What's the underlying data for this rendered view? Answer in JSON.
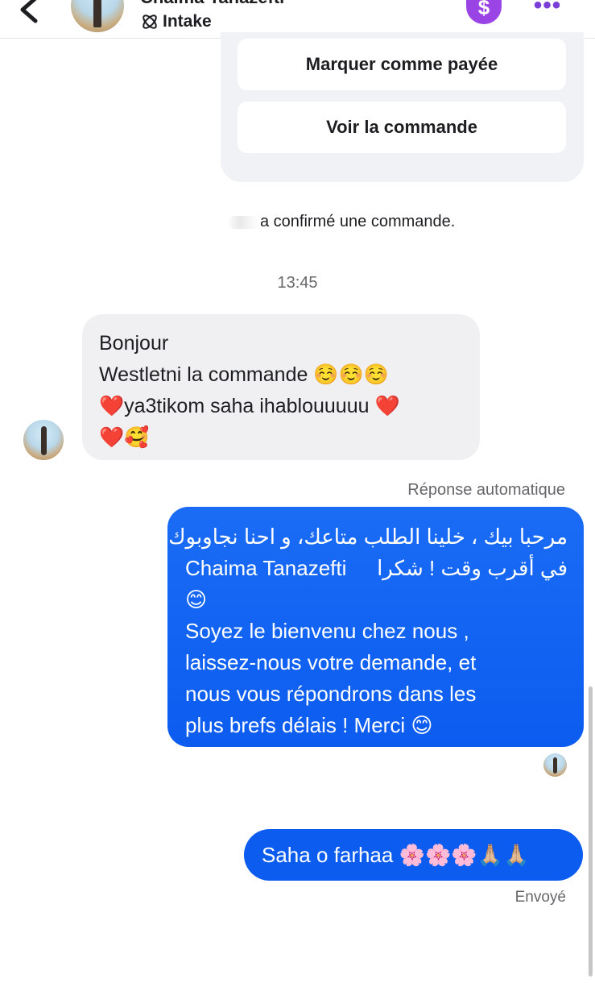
{
  "header": {
    "contact_name": "Chaima Tanazefti",
    "label": "Intake",
    "dollar_symbol": "$",
    "more_symbol": "•••"
  },
  "order_card": {
    "mark_paid_label": "Marquer comme payée",
    "view_order_label": "Voir la commande"
  },
  "system_message": {
    "text": "a confirmé une commande."
  },
  "timestamp": "13:45",
  "incoming_message": {
    "lines": [
      "Bonjour",
      "Westletni la commande ☺️☺️☺️",
      "❤️ya3tikom saha ihablouuuuu ❤️",
      "❤️🥰"
    ]
  },
  "auto_reply_label": "Réponse automatique",
  "auto_reply_message": {
    "arabic_line_1": "مرحبا بيك ، خلينا الطلب متاعك، و احنا نجاوبوك",
    "arabic_line_2": "في أقرب وقت ! شكرا",
    "name": "Chaima Tanazefti",
    "emoji_line": "😊",
    "french_lines": [
      "Soyez le bienvenu chez nous ,",
      "laissez-nous votre demande, et",
      "nous vous répondrons dans les",
      "plus brefs délais ! Merci 😊"
    ]
  },
  "sent_message": {
    "text": "Saha o farhaa 🌸🌸🌸🙏🏼🙏🏼"
  },
  "sent_status": "Envoyé",
  "colors": {
    "accent_blue": "#0c5cf0",
    "payment_purple": "#9b44e6",
    "bubble_gray": "#f0f0f2"
  }
}
